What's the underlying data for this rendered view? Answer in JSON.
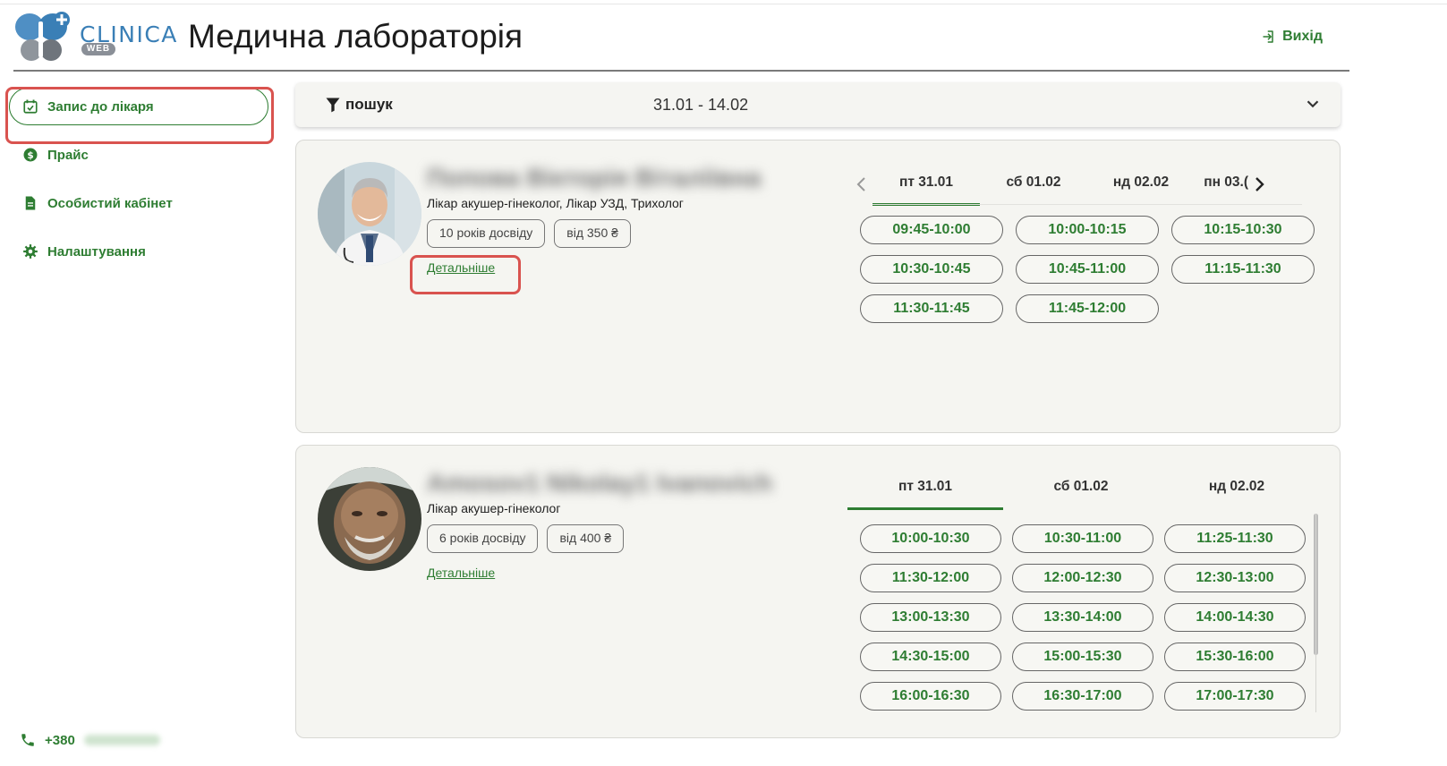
{
  "header": {
    "logo_text": "CLINICA",
    "logo_sub": "WEB",
    "title": "Медична лабораторія",
    "logout_label": "Вихід"
  },
  "sidebar": {
    "items": [
      {
        "label": "Запис до лікаря",
        "icon": "calendar-check-icon",
        "active": true
      },
      {
        "label": "Прайс",
        "icon": "dollar-circle-icon",
        "active": false
      },
      {
        "label": "Особистий кабінет",
        "icon": "document-icon",
        "active": false
      },
      {
        "label": "Налаштування",
        "icon": "gear-icon",
        "active": false
      }
    ],
    "phone": "+380"
  },
  "search": {
    "label": "пошук",
    "date_range": "31.01 - 14.02"
  },
  "doctors": [
    {
      "name": "Попова Вікторія Віталіївна",
      "specialty": "Лікар акушер-гінеколог, Лікар УЗД, Трихолог",
      "experience": "10 років досвіду",
      "price": "від 350 ₴",
      "details_label": "Детальніше",
      "tabs": [
        "пт 31.01",
        "сб 01.02",
        "нд 02.02",
        "пн 03.("
      ],
      "slots": [
        "09:45-10:00",
        "10:00-10:15",
        "10:15-10:30",
        "10:30-10:45",
        "10:45-11:00",
        "11:15-11:30",
        "11:30-11:45",
        "11:45-12:00"
      ]
    },
    {
      "name": "Amosov1 Nikolay1 Ivanovich",
      "specialty": "Лікар акушер-гінеколог",
      "experience": "6 років досвіду",
      "price": "від 400 ₴",
      "details_label": "Детальніше",
      "tabs": [
        "пт 31.01",
        "сб 01.02",
        "нд 02.02"
      ],
      "slots": [
        "10:00-10:30",
        "10:30-11:00",
        "11:25-11:30",
        "11:30-12:00",
        "12:00-12:30",
        "12:30-13:00",
        "13:00-13:30",
        "13:30-14:00",
        "14:00-14:30",
        "14:30-15:00",
        "15:00-15:30",
        "15:30-16:00",
        "16:00-16:30",
        "16:30-17:00",
        "17:00-17:30"
      ]
    }
  ],
  "colors": {
    "accent": "#2e7d32",
    "highlight": "#d9534f",
    "card_bg": "#f5f5f1"
  }
}
